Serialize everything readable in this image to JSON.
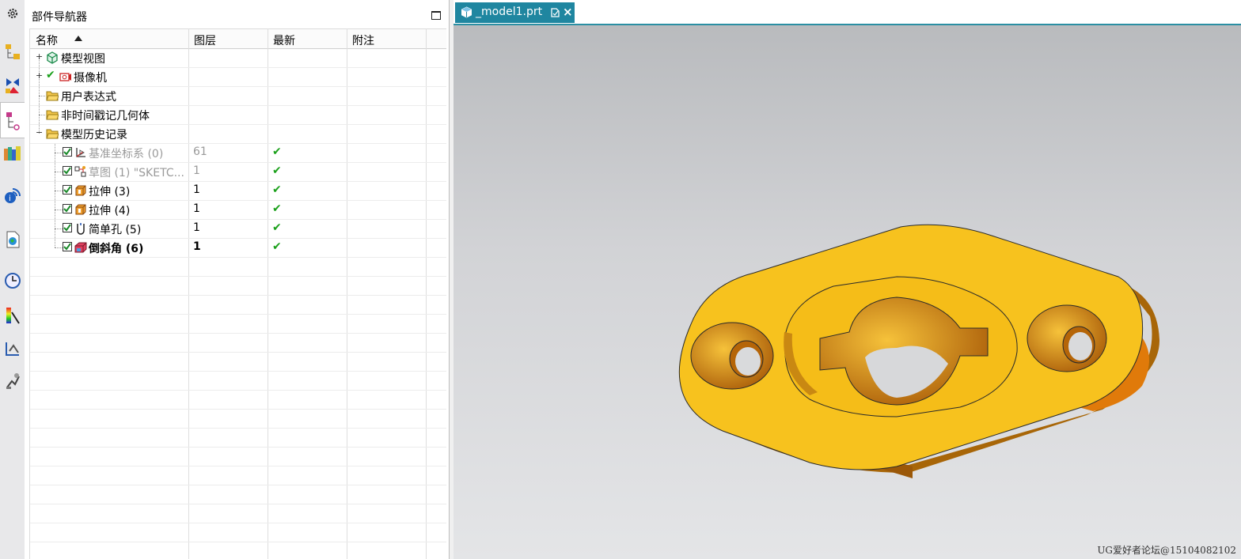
{
  "resource_bar": {
    "icons": [
      "settings-icon",
      "assembly-navigator-icon",
      "constraint-navigator-icon",
      "part-navigator-icon",
      "reuse-library-icon",
      "info-feed-icon",
      "web-browser-icon",
      "history-clock-icon",
      "material-palette-icon",
      "system-scene-icon",
      "process-studio-icon"
    ]
  },
  "navigator": {
    "title": "部件导航器",
    "columns": {
      "name": "名称",
      "layer": "图层",
      "latest": "最新",
      "note": "附注"
    },
    "rows": [
      {
        "name": "模型视图",
        "layer": "",
        "latest": false
      },
      {
        "name": "摄像机",
        "layer": "",
        "latest": false
      },
      {
        "name": "用户表达式",
        "layer": "",
        "latest": false
      },
      {
        "name": "非时间戳记几何体",
        "layer": "",
        "latest": false
      },
      {
        "name": "模型历史记录",
        "layer": "",
        "latest": false
      },
      {
        "name": "基准坐标系 (0)",
        "layer": "61",
        "latest": true
      },
      {
        "name": "草图 (1) \"SKETC...",
        "layer": "1",
        "latest": true
      },
      {
        "name": "拉伸 (3)",
        "layer": "1",
        "latest": true
      },
      {
        "name": "拉伸 (4)",
        "layer": "1",
        "latest": true
      },
      {
        "name": "简单孔 (5)",
        "layer": "1",
        "latest": true
      },
      {
        "name": "倒斜角 (6)",
        "layer": "1",
        "latest": true
      }
    ],
    "checkmark": "✔"
  },
  "viewport": {
    "tab_label": "_model1.prt",
    "model_color": "#f7c21e",
    "watermark": "UG爱好者论坛@15104082102"
  }
}
